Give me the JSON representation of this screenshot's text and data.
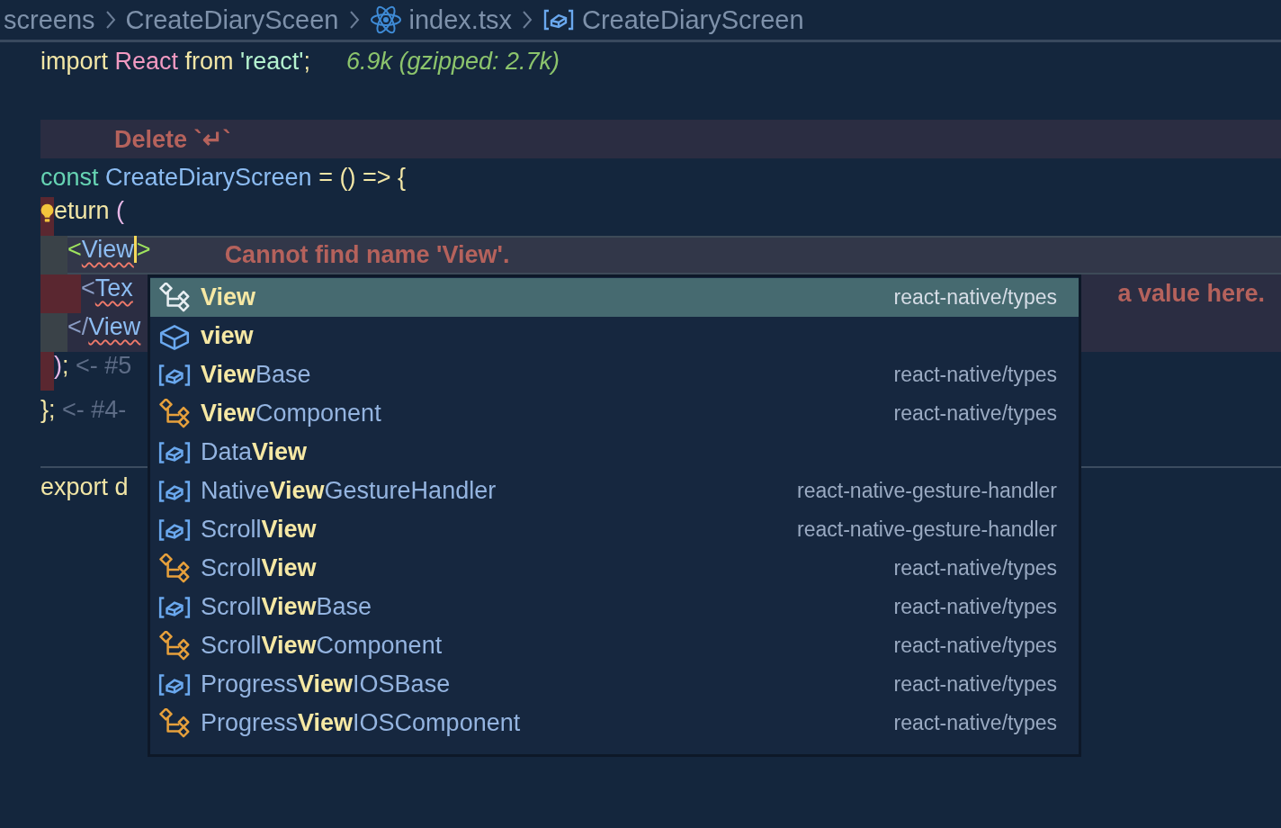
{
  "breadcrumb": [
    {
      "text": "screens",
      "kind": "folder"
    },
    {
      "text": "CreateDiarySceen",
      "kind": "folder"
    },
    {
      "text": "index.tsx",
      "kind": "file"
    },
    {
      "text": "CreateDiaryScreen",
      "kind": "symbol"
    }
  ],
  "lines": [
    {
      "kind": "code",
      "tokens": [
        {
          "text": "import ",
          "kind": "keyword"
        },
        {
          "text": "React",
          "kind": "import"
        },
        {
          "text": " from ",
          "kind": "keyword"
        },
        {
          "text": "'react'",
          "kind": "string"
        },
        {
          "text": ";",
          "kind": "keyword"
        }
      ],
      "hint": {
        "text": "6.9k (gzipped: 2.7k)",
        "kind": "size"
      }
    },
    {
      "kind": "blank"
    },
    {
      "kind": "fix",
      "hint": {
        "text": "Delete `↵`",
        "kind": "fix"
      }
    },
    {
      "kind": "code",
      "tokens": [
        {
          "text": "const ",
          "kind": "storage"
        },
        {
          "text": "CreateDiaryScreen",
          "kind": "function"
        },
        {
          "text": " = () => {",
          "kind": "keyword"
        }
      ]
    },
    {
      "kind": "code",
      "bulb": true,
      "error_gutter": true,
      "tokens": [
        {
          "text": "  eturn ",
          "kind": "keyword"
        },
        {
          "text": "(",
          "kind": "paren"
        }
      ]
    },
    {
      "kind": "current-line",
      "guide_gutter": true,
      "tokens": [
        {
          "text": "    <",
          "kind": "bracket"
        },
        {
          "text": "View",
          "kind": "tag",
          "squiggle": true,
          "cursor": true
        },
        {
          "text": ">",
          "kind": "bracket"
        }
      ],
      "hint": {
        "text": "Cannot find name 'View'.",
        "kind": "error"
      }
    },
    {
      "kind": "error-line",
      "error_gutter": true,
      "tokens": [
        {
          "text": "      <",
          "kind": "tag-dim"
        },
        {
          "text": "Tex",
          "kind": "tag",
          "squiggle": true
        }
      ],
      "hint": {
        "text": "a value here.",
        "kind": "error-tail"
      }
    },
    {
      "kind": "error-line",
      "guide_gutter": true,
      "tokens": [
        {
          "text": "    </",
          "kind": "tag-dim"
        },
        {
          "text": "View",
          "kind": "tag",
          "squiggle": true
        }
      ]
    },
    {
      "kind": "code",
      "error_gutter": true,
      "tokens": [
        {
          "text": "  )",
          "kind": "paren"
        },
        {
          "text": "; ",
          "kind": "keyword"
        },
        {
          "text": "<- #5",
          "kind": "comment"
        }
      ]
    },
    {
      "kind": "code",
      "tokens": [
        {
          "text": "}; ",
          "kind": "keyword"
        },
        {
          "text": "<- #4-",
          "kind": "comment"
        }
      ]
    },
    {
      "kind": "divider"
    },
    {
      "kind": "code",
      "tokens": [
        {
          "text": "export d",
          "kind": "keyword"
        }
      ]
    }
  ],
  "suggestions": [
    {
      "label": "**View**",
      "source": "react-native/types",
      "kind": "class",
      "selected": true
    },
    {
      "label": "**view**",
      "kind": "module",
      "selected": false
    },
    {
      "label": "**View**Base",
      "source": "react-native/types",
      "kind": "variable",
      "selected": false
    },
    {
      "label": "**View**Component",
      "source": "react-native/types",
      "kind": "class",
      "selected": false
    },
    {
      "label": "Data**View**",
      "kind": "variable",
      "selected": false
    },
    {
      "label": "Native**View**GestureHandler",
      "source": "react-native-gesture-handler",
      "kind": "variable",
      "selected": false
    },
    {
      "label": "Scroll**View**",
      "source": "react-native-gesture-handler",
      "kind": "variable",
      "selected": false
    },
    {
      "label": "Scroll**View**",
      "source": "react-native/types",
      "kind": "class",
      "selected": false
    },
    {
      "label": "Scroll**View**Base",
      "source": "react-native/types",
      "kind": "variable",
      "selected": false
    },
    {
      "label": "Scroll**View**Component",
      "source": "react-native/types",
      "kind": "class",
      "selected": false
    },
    {
      "label": "Progress**View**IOSBase",
      "source": "react-native/types",
      "kind": "variable",
      "selected": false
    },
    {
      "label": "Progress**View**IOSComponent",
      "source": "react-native/types",
      "kind": "class",
      "selected": false
    }
  ]
}
